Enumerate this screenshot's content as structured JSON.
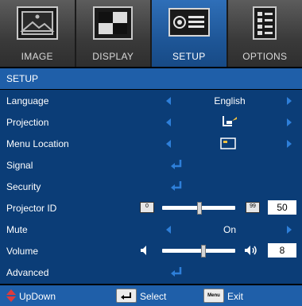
{
  "tabs": [
    {
      "label": "IMAGE",
      "icon": "image-icon"
    },
    {
      "label": "DISPLAY",
      "icon": "display-icon"
    },
    {
      "label": "SETUP",
      "icon": "projector-icon"
    },
    {
      "label": "OPTIONS",
      "icon": "options-icon"
    }
  ],
  "active_tab": "SETUP",
  "header": {
    "title": "SETUP"
  },
  "menu": {
    "language": {
      "label": "Language",
      "value": "English"
    },
    "projection": {
      "label": "Projection",
      "value_icon": "front-projection-icon"
    },
    "menu_location": {
      "label": "Menu Location",
      "value_icon": "menu-location-icon"
    },
    "signal": {
      "label": "Signal"
    },
    "security": {
      "label": "Security"
    },
    "projector_id": {
      "label": "Projector ID",
      "min": "0",
      "max": "99",
      "value": "50",
      "level": 0.5
    },
    "mute": {
      "label": "Mute",
      "value": "On"
    },
    "volume": {
      "label": "Volume",
      "value": "8",
      "level": 0.55
    },
    "advanced": {
      "label": "Advanced"
    }
  },
  "footer": {
    "updown_label": "UpDown",
    "select_label": "Select",
    "exit_label": "Exit",
    "menu_key": "Menu"
  },
  "colors": {
    "accent": "#1f5fa9",
    "menu_bg": "#0b3d77",
    "arrow": "#2e7fd9",
    "updown_icon": "#e03b3b"
  }
}
